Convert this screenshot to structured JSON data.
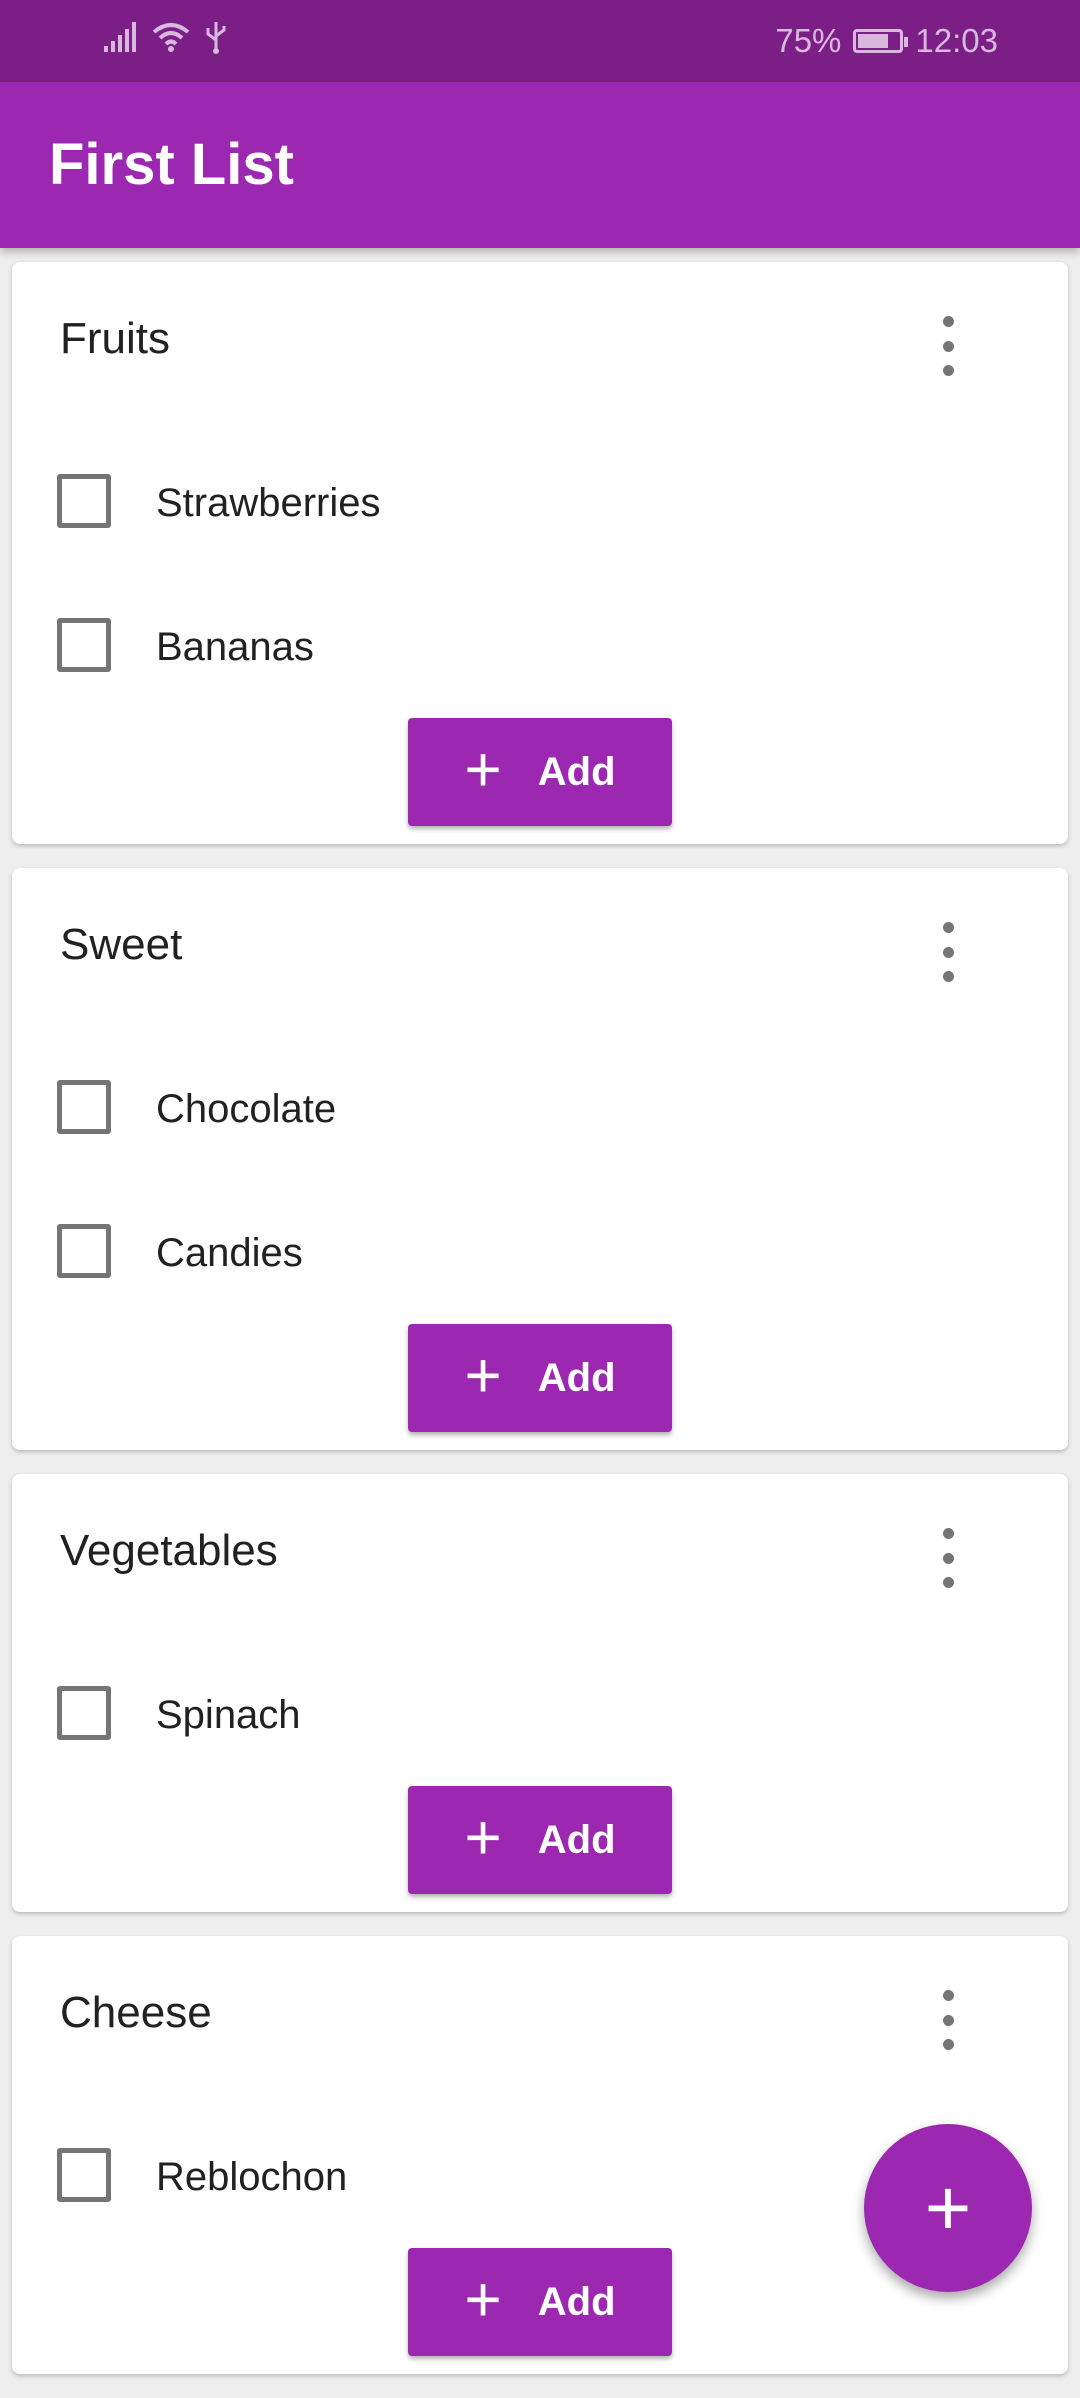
{
  "status_bar": {
    "battery_percent": "75%",
    "battery_level": 0.75,
    "time": "12:03",
    "icons": [
      "signal-icon",
      "wifi-icon",
      "usb-icon",
      "battery-charging-icon"
    ]
  },
  "app_bar": {
    "title": "First List"
  },
  "colors": {
    "primary": "#9c27b0",
    "primary_dark": "#7b1f86",
    "background": "#eeeeee",
    "card": "#ffffff"
  },
  "cards": [
    {
      "title": "Fruits",
      "items": [
        {
          "label": "Strawberries",
          "checked": false
        },
        {
          "label": "Bananas",
          "checked": false
        }
      ],
      "add_label": "Add"
    },
    {
      "title": "Sweet",
      "items": [
        {
          "label": "Chocolate",
          "checked": false
        },
        {
          "label": "Candies",
          "checked": false
        }
      ],
      "add_label": "Add"
    },
    {
      "title": "Vegetables",
      "items": [
        {
          "label": "Spinach",
          "checked": false
        }
      ],
      "add_label": "Add"
    },
    {
      "title": "Cheese",
      "items": [
        {
          "label": "Reblochon",
          "checked": false
        }
      ],
      "add_label": "Add"
    }
  ],
  "fab": {
    "icon": "plus-icon",
    "symbol": "+"
  }
}
